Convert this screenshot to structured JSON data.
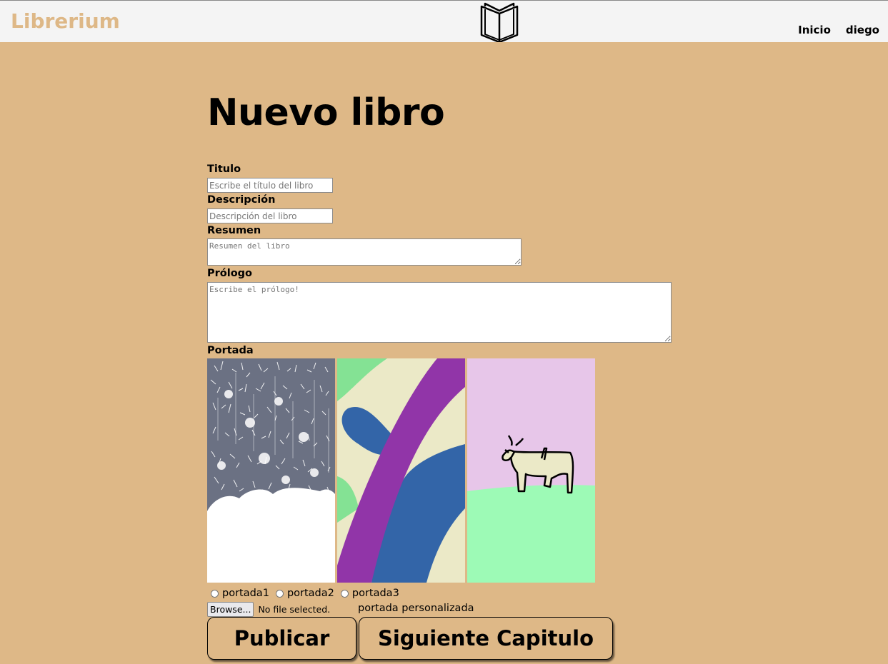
{
  "navbar": {
    "brand": "Librerium",
    "logo_icon": "open-book-icon",
    "links": [
      "Inicio",
      "diego"
    ]
  },
  "page": {
    "title": "Nuevo libro"
  },
  "form": {
    "titulo": {
      "label": "Titulo",
      "placeholder": "Escribe el título del libro"
    },
    "descripcion": {
      "label": "Descripción",
      "placeholder": "Descripción del libro"
    },
    "resumen": {
      "label": "Resumen",
      "placeholder": "Resumen del libro"
    },
    "prologo": {
      "label": "Prólogo",
      "placeholder": "Escribe el prólogo!"
    },
    "portada": {
      "label": "Portada",
      "options": [
        "portada1",
        "portada2",
        "portada3"
      ],
      "browse_label": "Browse...",
      "file_status": "No file selected.",
      "custom_label": "portada personalizada"
    },
    "buttons": {
      "publish": "Publicar",
      "next_chapter": "Siguiente Capitulo"
    }
  },
  "colors": {
    "background": "#deb887",
    "navbar": "#f4f4f4",
    "brand": "#deb887"
  }
}
